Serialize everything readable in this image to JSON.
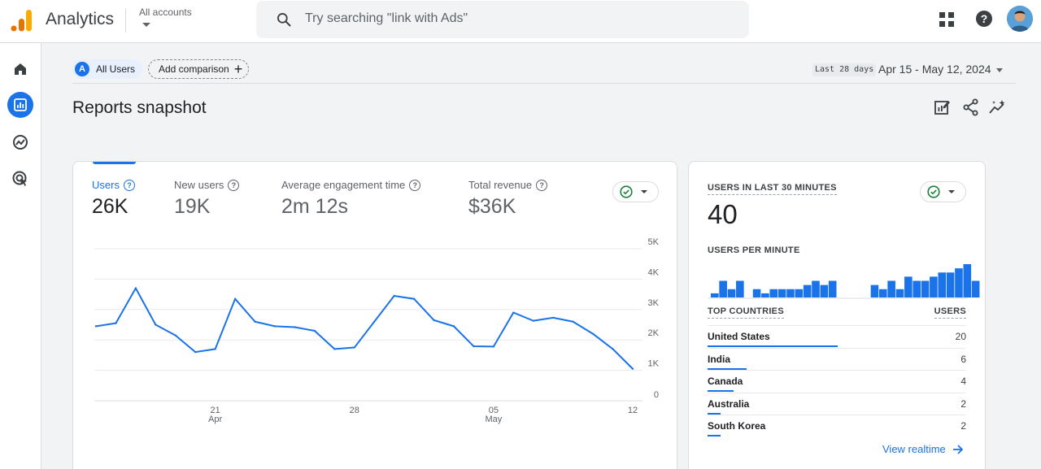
{
  "topbar": {
    "app_name": "Analytics",
    "account_label": "All accounts",
    "search_placeholder": "Try searching \"link with Ads\""
  },
  "header": {
    "segment_badge": "A",
    "segment_label": "All Users",
    "add_comparison_label": "Add comparison",
    "date_badge": "Last 28 days",
    "date_range": "Apr 15 - May 12, 2024",
    "page_title": "Reports snapshot"
  },
  "metrics": [
    {
      "label": "Users",
      "value": "26K"
    },
    {
      "label": "New users",
      "value": "19K"
    },
    {
      "label": "Average engagement time",
      "value": "2m 12s"
    },
    {
      "label": "Total revenue",
      "value": "$36K"
    }
  ],
  "chart_data": {
    "type": "line",
    "x": [
      "Apr 15",
      "Apr 16",
      "Apr 17",
      "Apr 18",
      "Apr 19",
      "Apr 20",
      "Apr 21",
      "Apr 22",
      "Apr 23",
      "Apr 24",
      "Apr 25",
      "Apr 26",
      "Apr 27",
      "Apr 28",
      "Apr 29",
      "Apr 30",
      "May 1",
      "May 2",
      "May 3",
      "May 4",
      "May 5",
      "May 6",
      "May 7",
      "May 8",
      "May 9",
      "May 10",
      "May 11",
      "May 12"
    ],
    "series": [
      {
        "values": [
          2450,
          2550,
          3700,
          2500,
          2150,
          1600,
          1700,
          3350,
          2600,
          2450,
          2420,
          2300,
          1700,
          1750,
          2600,
          3450,
          3350,
          2650,
          2450,
          1790,
          1780,
          2900,
          2630,
          2730,
          2600,
          2200,
          1700,
          1050
        ]
      }
    ],
    "x_tick_labels": [
      {
        "day": "21",
        "month": "Apr",
        "index": 6
      },
      {
        "day": "28",
        "month": "",
        "index": 13
      },
      {
        "day": "05",
        "month": "May",
        "index": 20
      },
      {
        "day": "12",
        "month": "",
        "index": 27
      }
    ],
    "y_tick_labels": [
      "5K",
      "4K",
      "3K",
      "2K",
      "1K",
      "0"
    ],
    "ylim": [
      0,
      5000
    ],
    "grid": true,
    "color": "#1a73e8"
  },
  "realtime": {
    "title": "USERS IN LAST 30 MINUTES",
    "value": "40",
    "per_minute_label": "USERS PER MINUTE",
    "per_minute_values": [
      1,
      4,
      2,
      4,
      0,
      2,
      1,
      2,
      2,
      2,
      2,
      3,
      4,
      3,
      4,
      0,
      0,
      0,
      0,
      3,
      2,
      4,
      2,
      5,
      4,
      4,
      5,
      6,
      6,
      7,
      8,
      4
    ],
    "top_countries_label": "TOP COUNTRIES",
    "users_label": "USERS",
    "countries": [
      {
        "name": "United States",
        "value": "20",
        "fraction": 1.0
      },
      {
        "name": "India",
        "value": "6",
        "fraction": 0.3
      },
      {
        "name": "Canada",
        "value": "4",
        "fraction": 0.2
      },
      {
        "name": "Australia",
        "value": "2",
        "fraction": 0.1
      },
      {
        "name": "South Korea",
        "value": "2",
        "fraction": 0.1
      }
    ],
    "view_realtime_label": "View realtime"
  },
  "colors": {
    "accent": "#1a73e8",
    "success": "#188038"
  }
}
